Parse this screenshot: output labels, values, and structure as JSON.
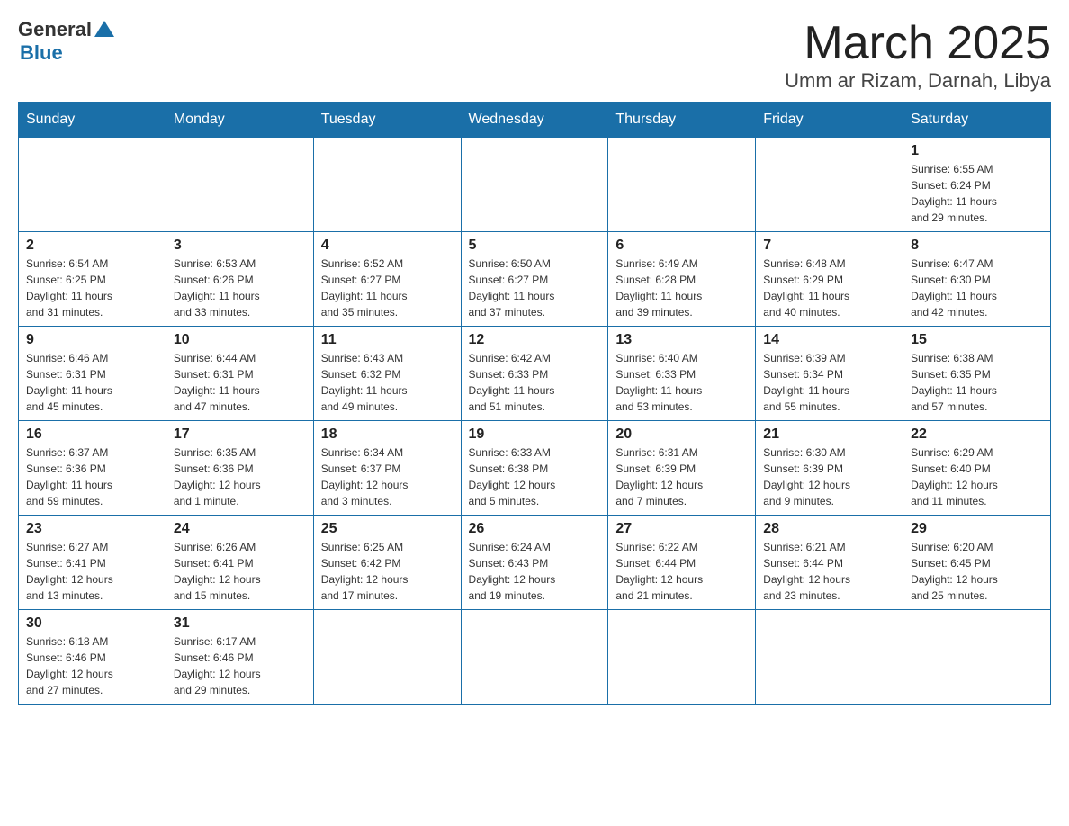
{
  "header": {
    "logo": {
      "general": "General",
      "triangle_color": "#1a6fa8",
      "blue": "Blue"
    },
    "title": "March 2025",
    "subtitle": "Umm ar Rizam, Darnah, Libya"
  },
  "calendar": {
    "weekdays": [
      "Sunday",
      "Monday",
      "Tuesday",
      "Wednesday",
      "Thursday",
      "Friday",
      "Saturday"
    ],
    "weeks": [
      [
        {
          "day": "",
          "info": ""
        },
        {
          "day": "",
          "info": ""
        },
        {
          "day": "",
          "info": ""
        },
        {
          "day": "",
          "info": ""
        },
        {
          "day": "",
          "info": ""
        },
        {
          "day": "",
          "info": ""
        },
        {
          "day": "1",
          "info": "Sunrise: 6:55 AM\nSunset: 6:24 PM\nDaylight: 11 hours\nand 29 minutes."
        }
      ],
      [
        {
          "day": "2",
          "info": "Sunrise: 6:54 AM\nSunset: 6:25 PM\nDaylight: 11 hours\nand 31 minutes."
        },
        {
          "day": "3",
          "info": "Sunrise: 6:53 AM\nSunset: 6:26 PM\nDaylight: 11 hours\nand 33 minutes."
        },
        {
          "day": "4",
          "info": "Sunrise: 6:52 AM\nSunset: 6:27 PM\nDaylight: 11 hours\nand 35 minutes."
        },
        {
          "day": "5",
          "info": "Sunrise: 6:50 AM\nSunset: 6:27 PM\nDaylight: 11 hours\nand 37 minutes."
        },
        {
          "day": "6",
          "info": "Sunrise: 6:49 AM\nSunset: 6:28 PM\nDaylight: 11 hours\nand 39 minutes."
        },
        {
          "day": "7",
          "info": "Sunrise: 6:48 AM\nSunset: 6:29 PM\nDaylight: 11 hours\nand 40 minutes."
        },
        {
          "day": "8",
          "info": "Sunrise: 6:47 AM\nSunset: 6:30 PM\nDaylight: 11 hours\nand 42 minutes."
        }
      ],
      [
        {
          "day": "9",
          "info": "Sunrise: 6:46 AM\nSunset: 6:31 PM\nDaylight: 11 hours\nand 45 minutes."
        },
        {
          "day": "10",
          "info": "Sunrise: 6:44 AM\nSunset: 6:31 PM\nDaylight: 11 hours\nand 47 minutes."
        },
        {
          "day": "11",
          "info": "Sunrise: 6:43 AM\nSunset: 6:32 PM\nDaylight: 11 hours\nand 49 minutes."
        },
        {
          "day": "12",
          "info": "Sunrise: 6:42 AM\nSunset: 6:33 PM\nDaylight: 11 hours\nand 51 minutes."
        },
        {
          "day": "13",
          "info": "Sunrise: 6:40 AM\nSunset: 6:33 PM\nDaylight: 11 hours\nand 53 minutes."
        },
        {
          "day": "14",
          "info": "Sunrise: 6:39 AM\nSunset: 6:34 PM\nDaylight: 11 hours\nand 55 minutes."
        },
        {
          "day": "15",
          "info": "Sunrise: 6:38 AM\nSunset: 6:35 PM\nDaylight: 11 hours\nand 57 minutes."
        }
      ],
      [
        {
          "day": "16",
          "info": "Sunrise: 6:37 AM\nSunset: 6:36 PM\nDaylight: 11 hours\nand 59 minutes."
        },
        {
          "day": "17",
          "info": "Sunrise: 6:35 AM\nSunset: 6:36 PM\nDaylight: 12 hours\nand 1 minute."
        },
        {
          "day": "18",
          "info": "Sunrise: 6:34 AM\nSunset: 6:37 PM\nDaylight: 12 hours\nand 3 minutes."
        },
        {
          "day": "19",
          "info": "Sunrise: 6:33 AM\nSunset: 6:38 PM\nDaylight: 12 hours\nand 5 minutes."
        },
        {
          "day": "20",
          "info": "Sunrise: 6:31 AM\nSunset: 6:39 PM\nDaylight: 12 hours\nand 7 minutes."
        },
        {
          "day": "21",
          "info": "Sunrise: 6:30 AM\nSunset: 6:39 PM\nDaylight: 12 hours\nand 9 minutes."
        },
        {
          "day": "22",
          "info": "Sunrise: 6:29 AM\nSunset: 6:40 PM\nDaylight: 12 hours\nand 11 minutes."
        }
      ],
      [
        {
          "day": "23",
          "info": "Sunrise: 6:27 AM\nSunset: 6:41 PM\nDaylight: 12 hours\nand 13 minutes."
        },
        {
          "day": "24",
          "info": "Sunrise: 6:26 AM\nSunset: 6:41 PM\nDaylight: 12 hours\nand 15 minutes."
        },
        {
          "day": "25",
          "info": "Sunrise: 6:25 AM\nSunset: 6:42 PM\nDaylight: 12 hours\nand 17 minutes."
        },
        {
          "day": "26",
          "info": "Sunrise: 6:24 AM\nSunset: 6:43 PM\nDaylight: 12 hours\nand 19 minutes."
        },
        {
          "day": "27",
          "info": "Sunrise: 6:22 AM\nSunset: 6:44 PM\nDaylight: 12 hours\nand 21 minutes."
        },
        {
          "day": "28",
          "info": "Sunrise: 6:21 AM\nSunset: 6:44 PM\nDaylight: 12 hours\nand 23 minutes."
        },
        {
          "day": "29",
          "info": "Sunrise: 6:20 AM\nSunset: 6:45 PM\nDaylight: 12 hours\nand 25 minutes."
        }
      ],
      [
        {
          "day": "30",
          "info": "Sunrise: 6:18 AM\nSunset: 6:46 PM\nDaylight: 12 hours\nand 27 minutes."
        },
        {
          "day": "31",
          "info": "Sunrise: 6:17 AM\nSunset: 6:46 PM\nDaylight: 12 hours\nand 29 minutes."
        },
        {
          "day": "",
          "info": ""
        },
        {
          "day": "",
          "info": ""
        },
        {
          "day": "",
          "info": ""
        },
        {
          "day": "",
          "info": ""
        },
        {
          "day": "",
          "info": ""
        }
      ]
    ]
  }
}
